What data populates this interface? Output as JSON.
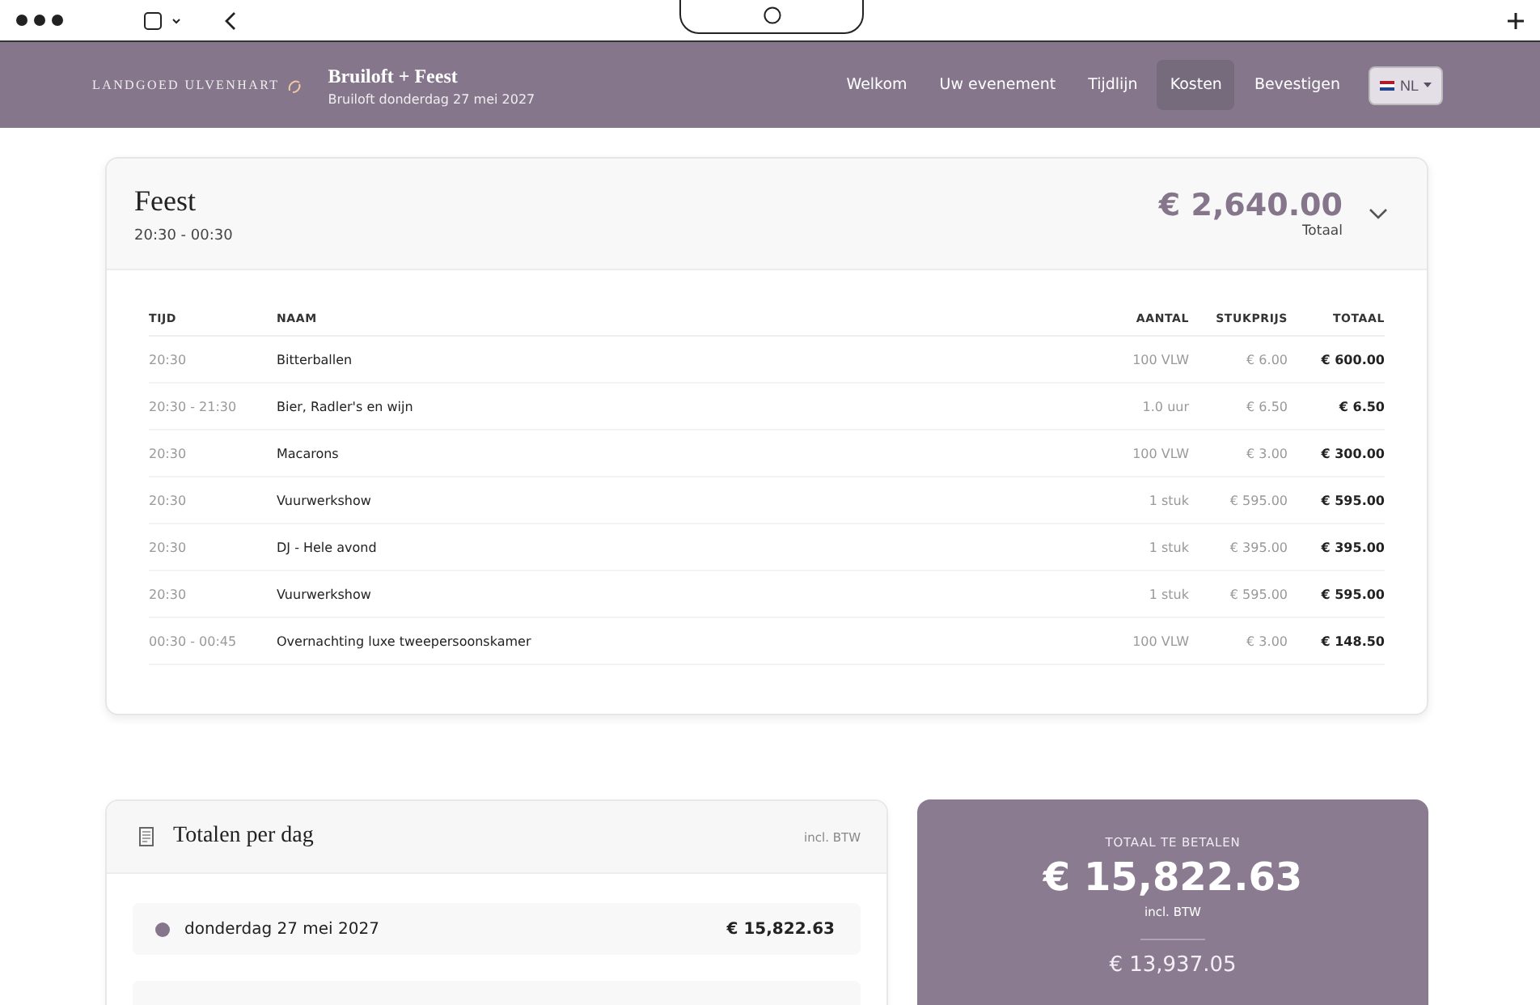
{
  "header": {
    "brand": "LANDGOED ULVENHART",
    "title": "Bruiloft + Feest",
    "subtitle": "Bruiloft donderdag 27 mei 2027",
    "nav": [
      {
        "label": "Welkom",
        "selected": false
      },
      {
        "label": "Uw evenement",
        "selected": false
      },
      {
        "label": "Tijdlijn",
        "selected": false
      },
      {
        "label": "Kosten",
        "selected": true
      },
      {
        "label": "Bevestigen",
        "selected": false
      }
    ],
    "language": "NL"
  },
  "event": {
    "title": "Feest",
    "time": "20:30 - 00:30",
    "total": "€ 2,640.00",
    "total_label": "Totaal",
    "expanded": true,
    "columns": [
      "TIJD",
      "NAAM",
      "AANTAL",
      "STUKPRIJS",
      "TOTAAL"
    ],
    "rows": [
      {
        "time": "20:30",
        "name": "Bitterballen",
        "quantity": "100 VLW",
        "unit_price": "€ 6.00",
        "total": "€ 600.00"
      },
      {
        "time": "20:30 - 21:30",
        "name": "Bier, Radler's en wijn",
        "quantity": "1.0 uur",
        "unit_price": "€ 6.50",
        "total": "€ 6.50"
      },
      {
        "time": "20:30",
        "name": "Macarons",
        "quantity": "100 VLW",
        "unit_price": "€ 3.00",
        "total": "€ 300.00"
      },
      {
        "time": "20:30",
        "name": "Vuurwerkshow",
        "quantity": "1 stuk",
        "unit_price": "€ 595.00",
        "total": "€ 595.00"
      },
      {
        "time": "20:30",
        "name": "DJ - Hele avond",
        "quantity": "1 stuk",
        "unit_price": "€ 395.00",
        "total": "€ 395.00"
      },
      {
        "time": "20:30",
        "name": "Vuurwerkshow",
        "quantity": "1 stuk",
        "unit_price": "€ 595.00",
        "total": "€ 595.00"
      },
      {
        "time": "00:30 - 00:45",
        "name": "Overnachting luxe tweepersoonskamer",
        "quantity": "100 VLW",
        "unit_price": "€ 3.00",
        "total": "€ 148.50"
      }
    ]
  },
  "day_totals": {
    "title": "Totalen per dag",
    "note": "incl. BTW",
    "days": [
      {
        "date": "donderdag 27 mei 2027",
        "amount": "€ 15,822.63",
        "color": "#85768c"
      }
    ]
  },
  "payment": {
    "label": "TOTAAL TE BETALEN",
    "amount": "€ 15,822.63",
    "note": "incl. BTW",
    "secondary_amount": "€ 13,937.05"
  }
}
